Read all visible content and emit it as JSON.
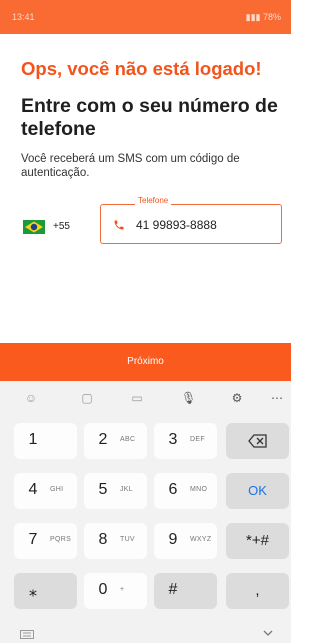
{
  "status_bar": {
    "time": "13:41",
    "battery": "78%"
  },
  "screen": {
    "error_heading": "Ops, você não está logado!",
    "main_heading": "Entre com o seu número de telefone",
    "subtitle": "Você receberá um SMS com um código de autenticação."
  },
  "phone_input": {
    "country_code": "+55",
    "legend": "Telefone",
    "value": "41 99893-8888"
  },
  "next_button": {
    "label": "Próximo"
  },
  "keyboard": {
    "keys": [
      {
        "num": "1",
        "letters": ""
      },
      {
        "num": "2",
        "letters": "ABC"
      },
      {
        "num": "3",
        "letters": "DEF"
      },
      {
        "num": "4",
        "letters": "GHI"
      },
      {
        "num": "5",
        "letters": "JKL"
      },
      {
        "num": "6",
        "letters": "MNO"
      },
      {
        "num": "7",
        "letters": "PQRS"
      },
      {
        "num": "8",
        "letters": "TUV"
      },
      {
        "num": "9",
        "letters": "WXYZ"
      },
      {
        "num": "⁎",
        "letters": ""
      },
      {
        "num": "0",
        "letters": "+"
      },
      {
        "num": "#",
        "letters": ""
      }
    ],
    "ok_label": "OK",
    "symbols_label": "*+#",
    "comma_label": ","
  },
  "colors": {
    "accent": "#fa5a1e",
    "heading_error": "#f2541b",
    "ok_blue": "#1a73e8"
  }
}
